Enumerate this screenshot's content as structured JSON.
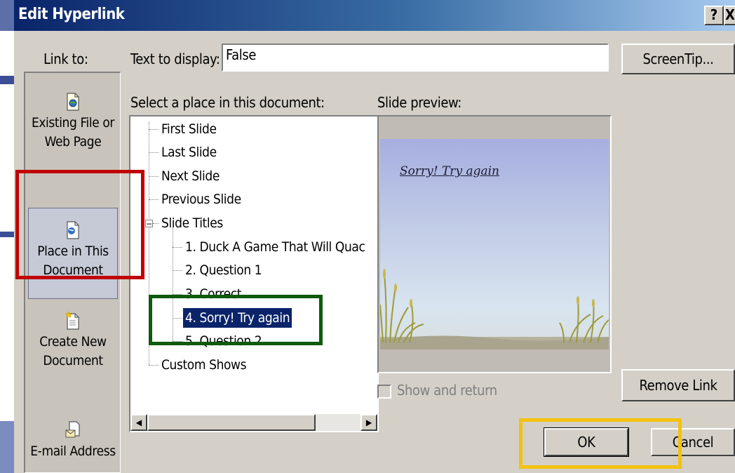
{
  "window": {
    "title": "Edit Hyperlink",
    "help_glyph": "?",
    "close_glyph": "X"
  },
  "link_to": {
    "label": "Link to:",
    "items": [
      {
        "label_line1": "Existing File or",
        "label_line2": "Web Page",
        "icon": "web-file-icon"
      },
      {
        "label_line1": "Place in This",
        "label_line2": "Document",
        "icon": "place-in-document-icon",
        "selected": true
      },
      {
        "label_line1": "Create New",
        "label_line2": "Document",
        "icon": "new-document-icon"
      },
      {
        "label_line1": "E-mail Address",
        "label_line2": "",
        "icon": "email-icon"
      }
    ]
  },
  "text_to_display": {
    "label": "Text to display:",
    "value": "False"
  },
  "screentip_button": "ScreenTip...",
  "place": {
    "label": "Select a place in this document:",
    "tree": {
      "expander_glyph": "−",
      "top_items": [
        "First Slide",
        "Last Slide",
        "Next Slide",
        "Previous Slide",
        "Slide Titles"
      ],
      "slide_titles": [
        "1. Duck A Game That Will Quac",
        "2. Question 1",
        "3. Correct",
        "4. Sorry! Try again",
        "5. Question 2"
      ],
      "selected": "4. Sorry! Try again",
      "bottom_item": "Custom Shows"
    },
    "scroll_left_glyph": "◀",
    "scroll_right_glyph": "▶"
  },
  "preview": {
    "label": "Slide preview:",
    "slide_text": "Sorry! Try again"
  },
  "show_and_return": {
    "label": "Show and return",
    "checked": false,
    "enabled": false
  },
  "remove_link_button": "Remove Link",
  "ok_button": "OK",
  "cancel_button": "Cancel",
  "colors": {
    "selection": "#0a246a",
    "highlight_red": "#c00000",
    "highlight_green": "#0e5a0e",
    "highlight_yellow": "#f4c20d"
  }
}
